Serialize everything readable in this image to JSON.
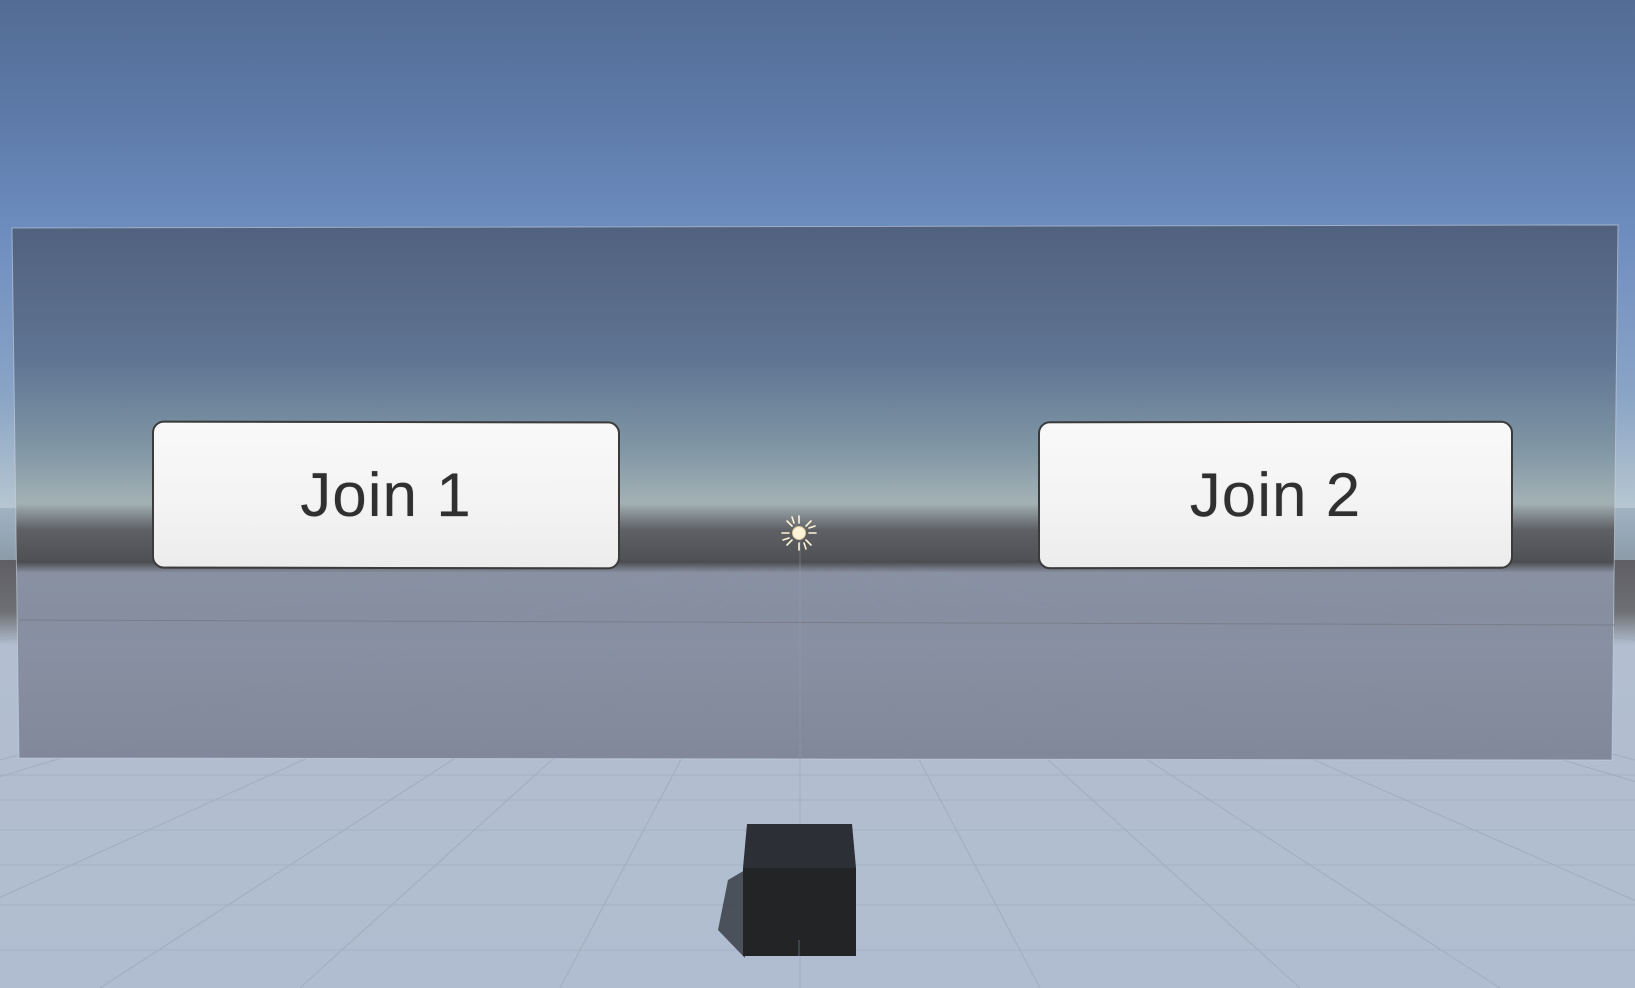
{
  "scene": {
    "sky_top_color": "#536c95",
    "horizon_color": "#a9bccd",
    "ground_color": "#b1bfd2",
    "panel_tint": "rgba(60,70,90,0.45)"
  },
  "canvas": {
    "buttons": [
      {
        "label": "Join 1"
      },
      {
        "label": "Join 2"
      }
    ]
  },
  "gizmos": {
    "light_icon": "directional-light-icon",
    "cube_object": "cube-mesh"
  }
}
